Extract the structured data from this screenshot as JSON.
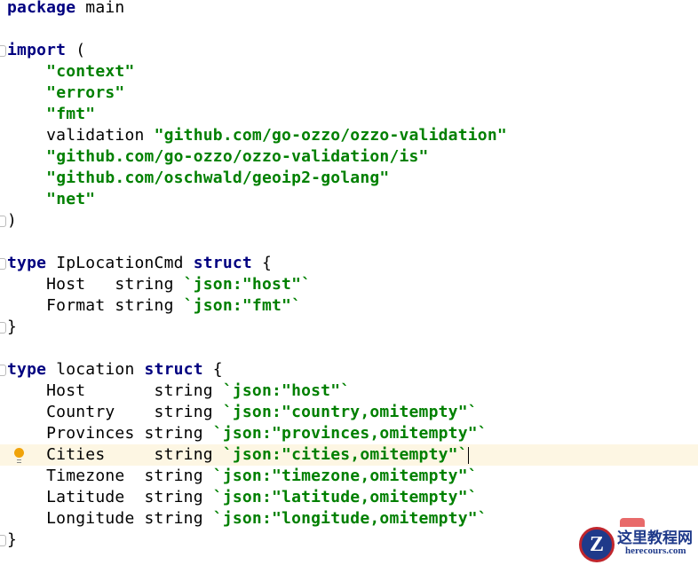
{
  "editor": {
    "highlighted_line": 21,
    "caret_line": 21,
    "lines": [
      [
        [
          "kw",
          "package"
        ],
        [
          "p",
          " main"
        ]
      ],
      [],
      [
        [
          "kw",
          "import"
        ],
        [
          "p",
          " ("
        ]
      ],
      [
        [
          "p",
          "    "
        ],
        [
          "str",
          "\"context\""
        ]
      ],
      [
        [
          "p",
          "    "
        ],
        [
          "str",
          "\"errors\""
        ]
      ],
      [
        [
          "p",
          "    "
        ],
        [
          "str",
          "\"fmt\""
        ]
      ],
      [
        [
          "p",
          "    validation "
        ],
        [
          "str",
          "\"github.com/go-ozzo/ozzo-validation\""
        ]
      ],
      [
        [
          "p",
          "    "
        ],
        [
          "str",
          "\"github.com/go-ozzo/ozzo-validation/is\""
        ]
      ],
      [
        [
          "p",
          "    "
        ],
        [
          "str",
          "\"github.com/oschwald/geoip2-golang\""
        ]
      ],
      [
        [
          "p",
          "    "
        ],
        [
          "str",
          "\"net\""
        ]
      ],
      [
        [
          "p",
          ")"
        ]
      ],
      [],
      [
        [
          "kw",
          "type"
        ],
        [
          "p",
          " IpLocationCmd "
        ],
        [
          "kw",
          "struct"
        ],
        [
          "p",
          " {"
        ]
      ],
      [
        [
          "p",
          "    Host   string "
        ],
        [
          "str",
          "`json:\"host\"`"
        ]
      ],
      [
        [
          "p",
          "    Format string "
        ],
        [
          "str",
          "`json:\"fmt\"`"
        ]
      ],
      [
        [
          "p",
          "}"
        ]
      ],
      [],
      [
        [
          "kw",
          "type"
        ],
        [
          "p",
          " location "
        ],
        [
          "kw",
          "struct"
        ],
        [
          "p",
          " {"
        ]
      ],
      [
        [
          "p",
          "    Host       string "
        ],
        [
          "str",
          "`json:\"host\"`"
        ]
      ],
      [
        [
          "p",
          "    Country    string "
        ],
        [
          "str",
          "`json:\"country,omitempty\"`"
        ]
      ],
      [
        [
          "p",
          "    Provinces string "
        ],
        [
          "str",
          "`json:\"provinces,omitempty\"`"
        ]
      ],
      [
        [
          "p",
          "    Cities     string "
        ],
        [
          "str",
          "`json:\"cities,omitempty\"`"
        ]
      ],
      [
        [
          "p",
          "    Timezone  string "
        ],
        [
          "str",
          "`json:\"timezone,omitempty\"`"
        ]
      ],
      [
        [
          "p",
          "    Latitude  string "
        ],
        [
          "str",
          "`json:\"latitude,omitempty\"`"
        ]
      ],
      [
        [
          "p",
          "    Longitude string "
        ],
        [
          "str",
          "`json:\"longitude,omitempty\"`"
        ]
      ],
      [
        [
          "p",
          "}"
        ]
      ]
    ],
    "fold_lines": [
      2,
      10,
      12,
      15,
      17,
      25
    ]
  },
  "watermark": {
    "logo_letter": "Z",
    "title": "这里教程网",
    "url": "herecours.com"
  }
}
